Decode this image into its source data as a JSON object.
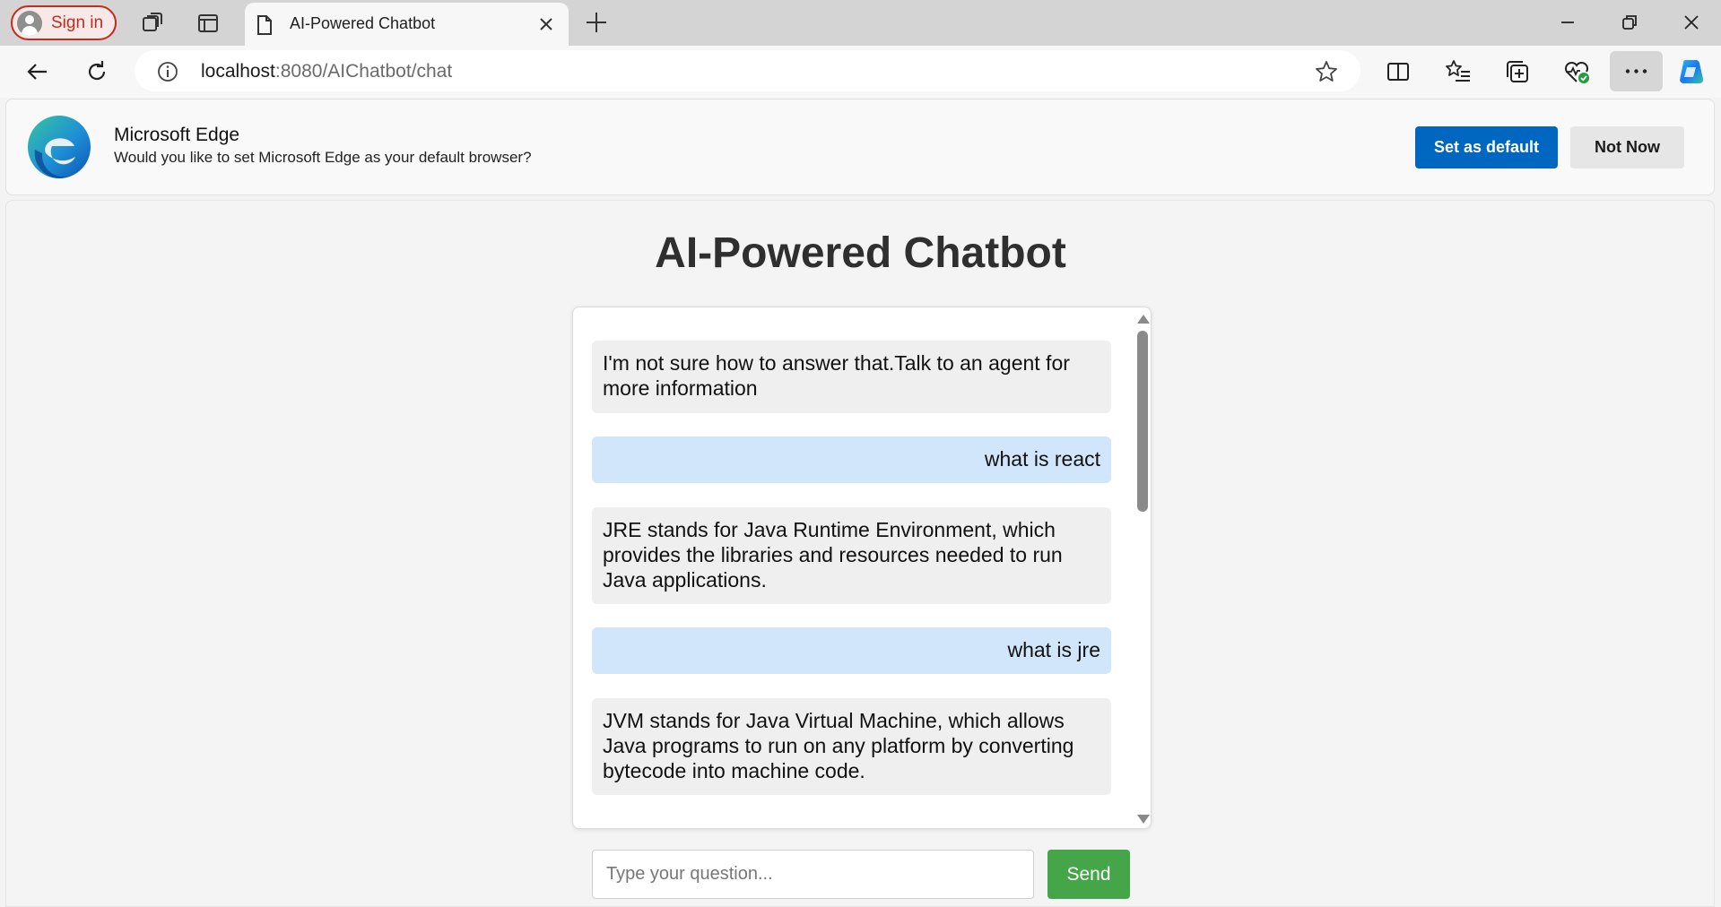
{
  "browser": {
    "sign_in_label": "Sign in",
    "tab_title": "AI-Powered Chatbot",
    "url_host": "localhost",
    "url_rest": ":8080/AIChatbot/chat",
    "icons": {
      "workspaces": "workspaces-icon",
      "tab_actions": "tab-actions-icon",
      "page": "page-icon",
      "close_tab": "close-icon",
      "new_tab": "plus-icon",
      "back": "back-arrow-icon",
      "refresh": "refresh-icon",
      "site_info": "info-icon",
      "favorite": "star-icon",
      "split_screen": "split-screen-icon",
      "favorites": "favorites-list-icon",
      "collections": "collections-icon",
      "browser_essentials": "heart-pulse-icon",
      "more": "ellipsis-icon",
      "copilot": "copilot-icon"
    }
  },
  "banner": {
    "title": "Microsoft Edge",
    "text": "Would you like to set Microsoft Edge as your default browser?",
    "primary_label": "Set as default",
    "secondary_label": "Not Now",
    "accent_color": "#0067c0"
  },
  "page": {
    "title": "AI-Powered Chatbot",
    "messages": [
      {
        "role": "bot",
        "text": "I'm not sure how to answer that.Talk to an agent for more information"
      },
      {
        "role": "user",
        "text": "what is react"
      },
      {
        "role": "bot",
        "text": "JRE stands for Java Runtime Environment, which provides the libraries and resources needed to run Java applications."
      },
      {
        "role": "user",
        "text": "what is jre"
      },
      {
        "role": "bot",
        "text": "JVM stands for Java Virtual Machine, which allows Java programs to run on any platform by converting bytecode into machine code."
      }
    ],
    "input_placeholder": "Type your question...",
    "send_label": "Send",
    "colors": {
      "bot_bubble": "#efefef",
      "user_bubble": "#d1e6fb",
      "send_button": "#45a649"
    }
  }
}
